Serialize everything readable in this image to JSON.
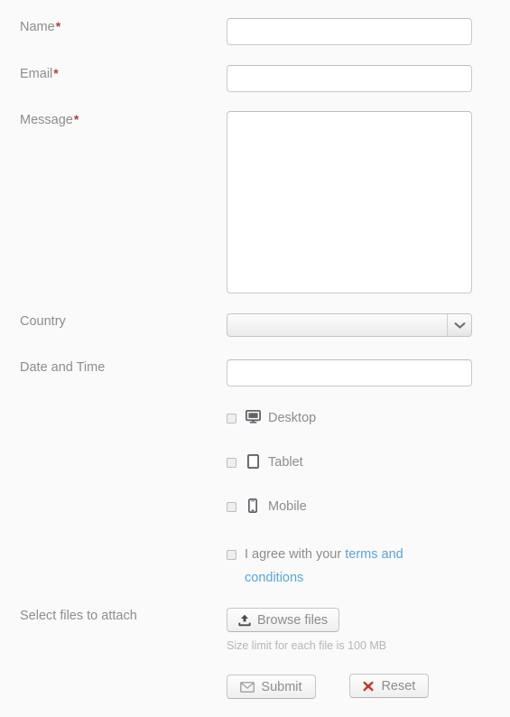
{
  "form": {
    "fields": {
      "name": {
        "label": "Name",
        "required_mark": "*",
        "value": "",
        "placeholder": ""
      },
      "email": {
        "label": "Email",
        "required_mark": "*",
        "value": "",
        "placeholder": ""
      },
      "message": {
        "label": "Message",
        "required_mark": "*",
        "value": "",
        "placeholder": ""
      },
      "country": {
        "label": "Country",
        "selected": "",
        "placeholder": ""
      },
      "datetime": {
        "label": "Date and Time",
        "value": "",
        "placeholder": ""
      },
      "attach": {
        "label": "Select files to attach"
      }
    },
    "devices": [
      {
        "label": "Desktop",
        "icon": "desktop-icon",
        "checked": false
      },
      {
        "label": "Tablet",
        "icon": "tablet-icon",
        "checked": false
      },
      {
        "label": "Mobile",
        "icon": "mobile-icon",
        "checked": false
      }
    ],
    "terms": {
      "text_before": "I agree with your ",
      "link_text": "terms and conditions",
      "checked": false
    },
    "upload": {
      "button_label": "Browse files",
      "button_icon": "upload-icon",
      "size_hint": "Size limit for each file is 100 MB"
    },
    "actions": {
      "submit": {
        "label": "Submit",
        "icon": "envelope-icon"
      },
      "reset": {
        "label": "Reset",
        "icon": "cross-icon"
      }
    }
  },
  "colors": {
    "page_background": "#fafafa",
    "label_text": "#8d8d8d",
    "required_asterisk": "#a8423f",
    "link": "#5ba3da",
    "input_border": "#c9c9c9",
    "reset_icon": "#c0392b",
    "hint_text": "#b6b6b6"
  }
}
